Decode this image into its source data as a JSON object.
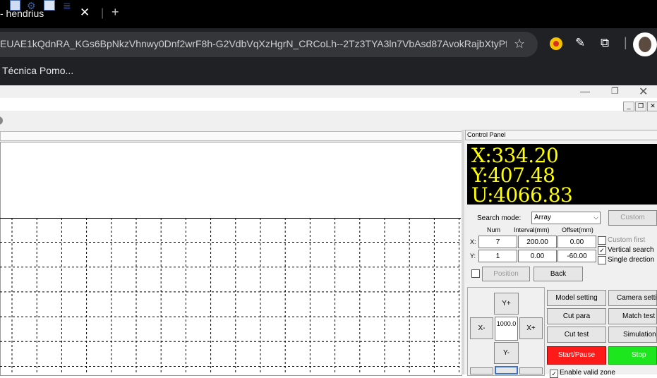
{
  "browser": {
    "tab_title": "- hendrius",
    "tab_close": "✕",
    "new_tab": "+",
    "url": "EUAE1kQdnRA_KGs6BpNkzVhnwy0Dnf2wrF8h-G2VdbVqXzHgrN_CRCoLh--2Tz3TYA3ln7VbAsd87AvokRajbXtyPfu...",
    "star": "☆",
    "bookmark_1": "Técnica Pomo..."
  },
  "window": {
    "minimize": "—",
    "maximize": "❐",
    "close": "✕",
    "mdi_min": "_",
    "mdi_restore": "❐",
    "mdi_close": "✕"
  },
  "control_panel": {
    "title": "Control Panel",
    "coords": {
      "x": "X:334.20",
      "y": "Y:407.48",
      "u": "U:4066.83"
    },
    "search_mode_label": "Search mode:",
    "search_mode_value": "Array",
    "custom_button": "Custom",
    "col_num": "Num",
    "col_interval": "Interval(mm)",
    "col_offset": "Offset(mm)",
    "row_x_label": "X:",
    "row_y_label": "Y:",
    "x_num": "7",
    "x_interval": "200.00",
    "x_offset": "0.00",
    "y_num": "1",
    "y_interval": "0.00",
    "y_offset": "-60.00",
    "custom_first": "Custom first",
    "vertical_search": "Vertical search",
    "single_direction": "Single drection",
    "position_button": "Position",
    "back_button": "Back",
    "y_plus": "Y+",
    "y_minus": "Y-",
    "x_plus": "X+",
    "x_minus": "X-",
    "step_value": "1000.0",
    "model_setting": "Model setting",
    "camera_setting": "Camera settin",
    "cut_para": "Cut para",
    "match_test": "Match test",
    "cut_test": "Cut test",
    "simulation": "Simulation",
    "start_pause": "Start/Pause",
    "stop": "Stop",
    "enable_valid_zone": "Enable valid zone"
  },
  "colors": {
    "start": "#ff1a1a",
    "stop": "#1ee61e",
    "coord_text": "#ffff00"
  }
}
